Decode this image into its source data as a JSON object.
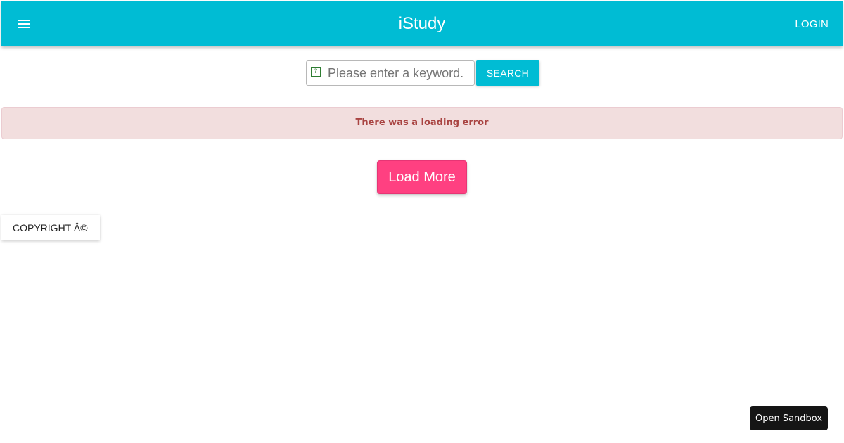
{
  "header": {
    "title": "iStudy",
    "menu_icon": "hamburger-menu-icon",
    "login_label": "LOGIN",
    "background_color": "#00bcd4"
  },
  "search": {
    "placeholder": "Please enter a keyword.",
    "value": "",
    "glyph": "?",
    "button_label": "SEARCH"
  },
  "alert": {
    "message": "There was a loading error",
    "background_color": "#f2dede",
    "text_color": "#a94442"
  },
  "load_more": {
    "label": "Load More",
    "color": "#ff4081"
  },
  "footer": {
    "copyright": "COPYRIGHT Â©"
  },
  "sandbox": {
    "label": "Open Sandbox"
  }
}
